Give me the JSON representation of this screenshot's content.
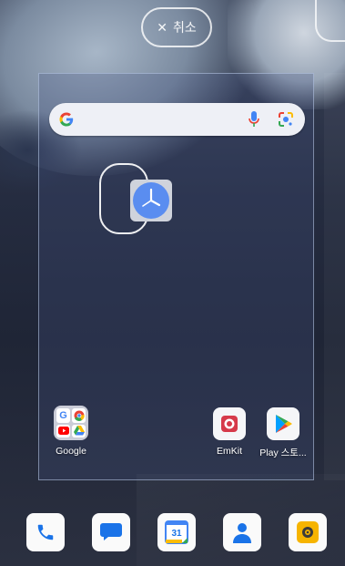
{
  "top": {
    "cancel_icon": "close-icon",
    "cancel_label": "취소"
  },
  "search": {
    "logo": "google-g-icon",
    "mic_icon": "mic-icon",
    "lens_icon": "lens-icon"
  },
  "widgets": {
    "clock_icon": "clock-icon"
  },
  "apps": [
    {
      "label": "Google",
      "icon": "google-folder-icon"
    },
    {
      "label": "EmKit",
      "icon": "emkit-icon"
    },
    {
      "label": "Play 스토...",
      "icon": "play-store-icon"
    }
  ],
  "dock": [
    {
      "icon": "phone-icon"
    },
    {
      "icon": "messages-icon"
    },
    {
      "icon": "calendar-icon",
      "text": "31"
    },
    {
      "icon": "contacts-icon"
    },
    {
      "icon": "camera-icon"
    }
  ],
  "colors": {
    "google_blue": "#4285F4",
    "google_red": "#EA4335",
    "google_yellow": "#FBBC05",
    "google_green": "#34A853",
    "phone_blue": "#1a73e8",
    "camera_yellow": "#f6b400"
  }
}
